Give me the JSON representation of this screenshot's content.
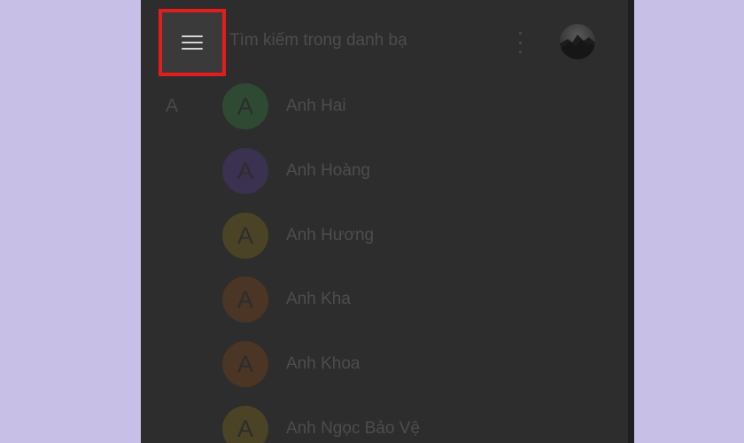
{
  "topbar": {
    "menu_icon": "hamburger-menu-icon",
    "search_placeholder": "Tìm kiếm trong danh bạ",
    "more_icon": "more-vertical-icon",
    "highlight_color": "#e31c1c"
  },
  "section": {
    "letter": "A"
  },
  "contacts": [
    {
      "initial": "A",
      "name": "Anh Hai",
      "color": "#2f4a33"
    },
    {
      "initial": "A",
      "name": "Anh Hoàng",
      "color": "#3b3150"
    },
    {
      "initial": "A",
      "name": "Anh Hương",
      "color": "#4a4325"
    },
    {
      "initial": "A",
      "name": "Anh Kha",
      "color": "#4b3524"
    },
    {
      "initial": "A",
      "name": "Anh Khoa",
      "color": "#4b3524"
    },
    {
      "initial": "A",
      "name": "Anh Ngọc Bảo Vệ",
      "color": "#4a4325"
    }
  ]
}
